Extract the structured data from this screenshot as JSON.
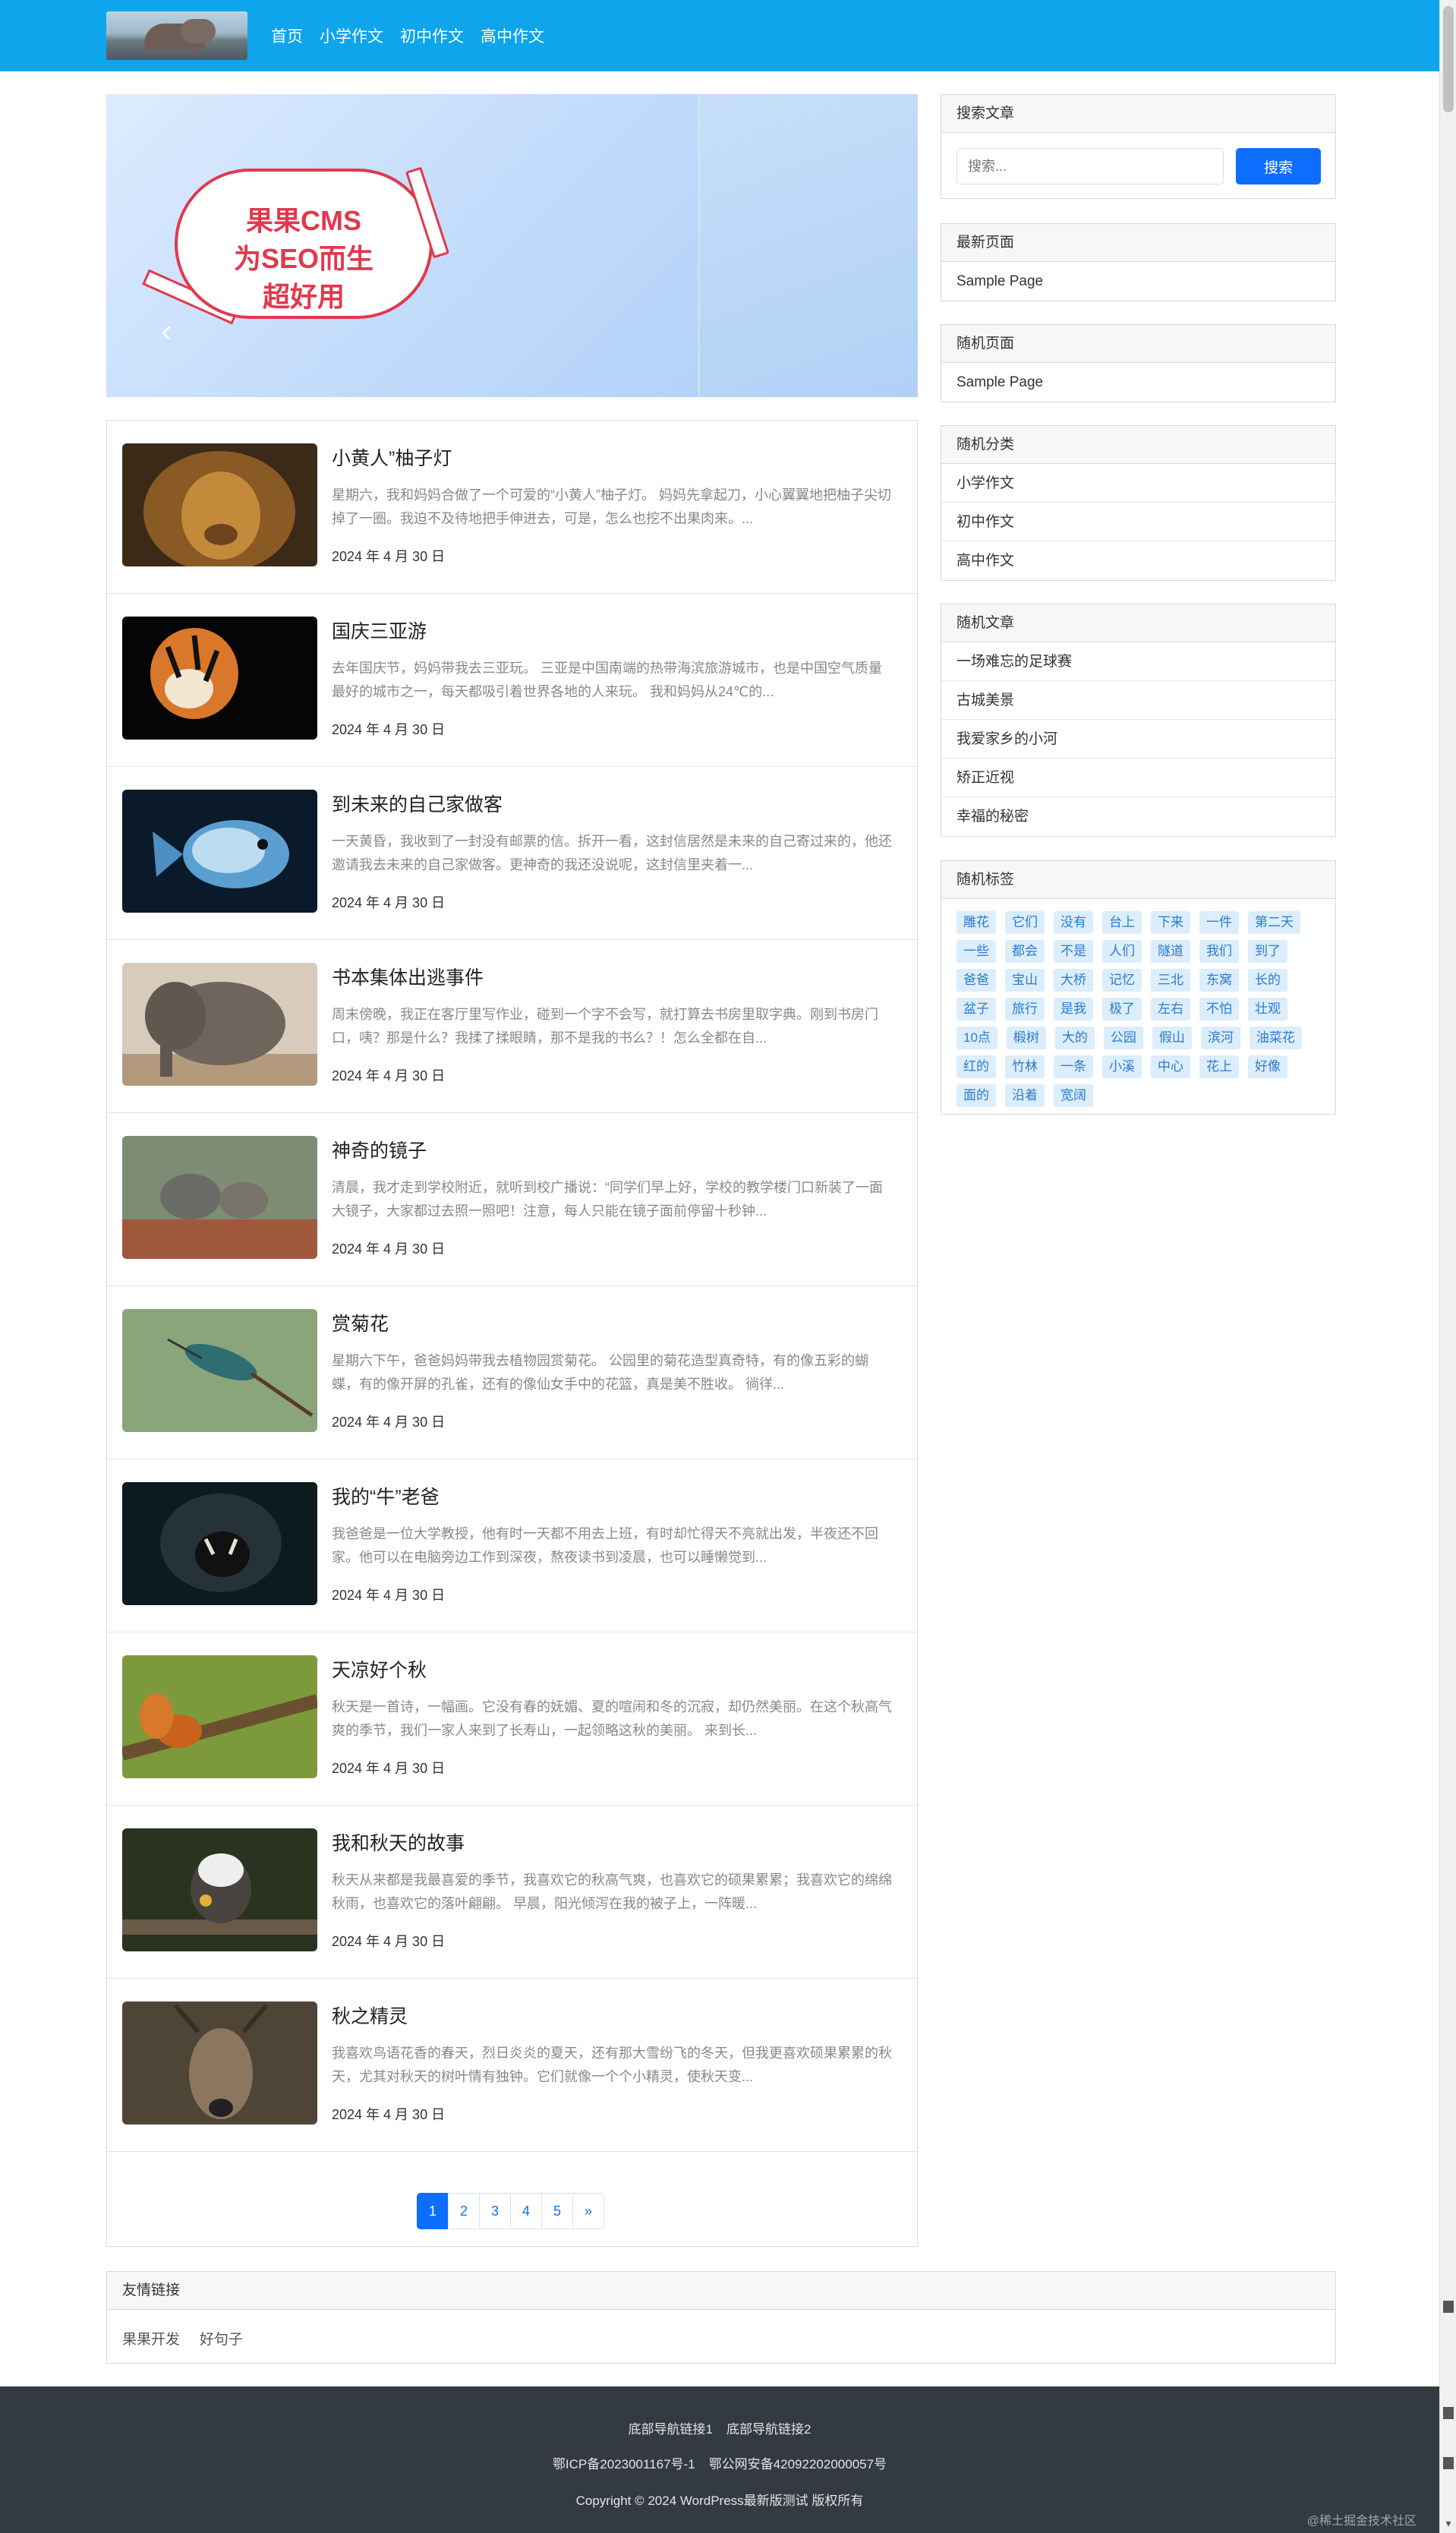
{
  "nav": {
    "items": [
      "首页",
      "小学作文",
      "初中作文",
      "高中作文"
    ]
  },
  "banner": {
    "lines": [
      "果果CMS",
      "为SEO而生",
      "超好用"
    ],
    "prev": "‹",
    "next": "›"
  },
  "posts": [
    {
      "title": "小黄人”柚子灯",
      "excerpt": "星期六，我和妈妈合做了一个可爱的“小黄人”柚子灯。 妈妈先拿起刀，小心翼翼地把柚子尖切掉了一圈。我迫不及待地把手伸进去，可是，怎么也挖不出果肉来。...",
      "date": "2024 年 4 月 30 日",
      "image": "lion"
    },
    {
      "title": "国庆三亚游",
      "excerpt": "去年国庆节，妈妈带我去三亚玩。 三亚是中国南端的热带海滨旅游城市，也是中国空气质量最好的城市之一，每天都吸引着世界各地的人来玩。 我和妈妈从24℃的...",
      "date": "2024 年 4 月 30 日",
      "image": "tiger"
    },
    {
      "title": "到未来的自己家做客",
      "excerpt": "一天黄昏，我收到了一封没有邮票的信。拆开一看，这封信居然是未来的自己寄过来的，他还邀请我去未来的自己家做客。更神奇的我还没说呢，这封信里夹着一...",
      "date": "2024 年 4 月 30 日",
      "image": "fish"
    },
    {
      "title": "书本集体出逃事件",
      "excerpt": "周末傍晚，我正在客厅里写作业，碰到一个字不会写，就打算去书房里取字典。刚到书房门口，咦？那是什么？我揉了揉眼睛，那不是我的书么？！怎么全都在自...",
      "date": "2024 年 4 月 30 日",
      "image": "elephant"
    },
    {
      "title": "神奇的镜子",
      "excerpt": "清晨，我才走到学校附近，就听到校广播说：“同学们早上好，学校的教学楼门口新装了一面大镜子，大家都过去照一照吧！注意，每人只能在镜子面前停留十秒钟...",
      "date": "2024 年 4 月 30 日",
      "image": "squirrel"
    },
    {
      "title": "赏菊花",
      "excerpt": "星期六下午，爸爸妈妈带我去植物园赏菊花。 公园里的菊花造型真奇特，有的像五彩的蝴蝶，有的像开屏的孔雀，还有的像仙女手中的花篮，真是美不胜收。 徜徉...",
      "date": "2024 年 4 月 30 日",
      "image": "bird"
    },
    {
      "title": "我的“牛”老爸",
      "excerpt": "我爸爸是一位大学教授，他有时一天都不用去上班，有时却忙得天不亮就出发，半夜还不回家。他可以在电脑旁边工作到深夜，熬夜读书到凌晨，也可以睡懒觉到...",
      "date": "2024 年 4 月 30 日",
      "image": "roar"
    },
    {
      "title": "天凉好个秋",
      "excerpt": "秋天是一首诗，一幅画。它没有春的妩媚、夏的喧闹和冬的沉寂，却仍然美丽。在这个秋高气爽的季节，我们一家人来到了长寿山，一起领略这秋的美丽。 来到长...",
      "date": "2024 年 4 月 30 日",
      "image": "redsquirrel"
    },
    {
      "title": "我和秋天的故事",
      "excerpt": "秋天从来都是我最喜爱的季节，我喜欢它的秋高气爽，也喜欢它的硕果累累；我喜欢它的绵绵秋雨，也喜欢它的落叶翩翩。 早晨，阳光倾泻在我的被子上，一阵暖...",
      "date": "2024 年 4 月 30 日",
      "image": "monkey"
    },
    {
      "title": "秋之精灵",
      "excerpt": "我喜欢鸟语花香的春天，烈日炎炎的夏天，还有那大雪纷飞的冬天，但我更喜欢硕果累累的秋天，尤其对秋天的树叶情有独钟。它们就像一个个小精灵，使秋天变...",
      "date": "2024 年 4 月 30 日",
      "image": "deer"
    }
  ],
  "pagination": {
    "pages": [
      "1",
      "2",
      "3",
      "4",
      "5"
    ],
    "next": "»",
    "current": "1"
  },
  "sidebar": {
    "search": {
      "title": "搜索文章",
      "placeholder": "搜索...",
      "button": "搜索"
    },
    "latest": {
      "title": "最新页面",
      "items": [
        "Sample Page"
      ]
    },
    "random_page": {
      "title": "随机页面",
      "items": [
        "Sample Page"
      ]
    },
    "random_category": {
      "title": "随机分类",
      "items": [
        "小学作文",
        "初中作文",
        "高中作文"
      ]
    },
    "random_article": {
      "title": "随机文章",
      "items": [
        "一场难忘的足球赛",
        "古城美景",
        "我爱家乡的小河",
        "矫正近视",
        "幸福的秘密"
      ]
    },
    "random_tags": {
      "title": "随机标签",
      "items": [
        "雕花",
        "它们",
        "没有",
        "台上",
        "下来",
        "一件",
        "第二天",
        "一些",
        "都会",
        "不是",
        "人们",
        "隧道",
        "我们",
        "到了",
        "爸爸",
        "宝山",
        "大桥",
        "记忆",
        "三北",
        "东窝",
        "长的",
        "盆子",
        "旅行",
        "是我",
        "极了",
        "左右",
        "不怕",
        "壮观",
        "10点",
        "椴树",
        "大的",
        "公园",
        "假山",
        "滨河",
        "油菜花",
        "红的",
        "竹林",
        "一条",
        "小溪",
        "中心",
        "花上",
        "好像",
        "面的",
        "沿着",
        "宽阔"
      ]
    }
  },
  "friends": {
    "title": "友情链接",
    "links": [
      "果果开发",
      "好句子"
    ]
  },
  "footer": {
    "nav": [
      "底部导航链接1",
      "底部导航链接2"
    ],
    "icp": [
      "鄂ICP备2023001167号-1",
      "鄂公网安备42092202000057号"
    ],
    "copyright": "Copyright © 2024 WordPress最新版测试 版权所有"
  },
  "watermark": "@稀土掘金技术社区",
  "colors": {
    "header": "#0ea5ec",
    "primary": "#0d6efd",
    "footer": "#333a41"
  }
}
